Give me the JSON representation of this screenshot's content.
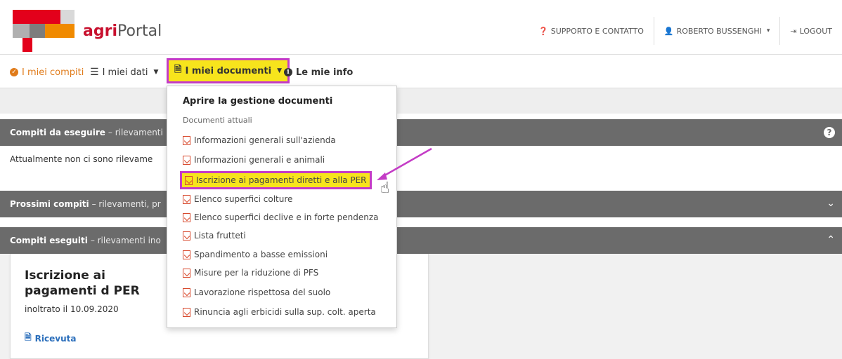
{
  "app": {
    "brand_prefix": "agri",
    "brand_suffix": "Portal"
  },
  "topbar": {
    "support": "SUPPORTO E CONTATTO",
    "user": "ROBERTO BUSSENGHI",
    "logout": "LOGOUT"
  },
  "nav": {
    "tasks": "I miei compiti",
    "data": "I miei dati",
    "documents": "I miei documenti",
    "info": "Le mie info"
  },
  "panels": {
    "todo": {
      "bold": "Compiti da eseguire",
      "rest": "– rilevamenti",
      "body": "Attualmente non ci sono rilevame"
    },
    "next": {
      "bold": "Prossimi compiti",
      "rest": "– rilevamenti, pr"
    },
    "done": {
      "bold": "Compiti eseguiti",
      "rest": "– rilevamenti ino"
    }
  },
  "card": {
    "title": "Iscrizione ai pagamenti d PER",
    "date": "inoltrato il 10.09.2020",
    "receipt": "Ricevuta"
  },
  "dropdown": {
    "header": "Aprire la gestione documenti",
    "section": "Documenti attuali",
    "items": [
      "Informazioni generali sull'azienda",
      "Informazioni generali e animali",
      "Iscrizione ai pagamenti diretti e alla PER",
      "Elenco superfici colture",
      "Elenco superfici declive e in forte pendenza",
      "Lista frutteti",
      "Spandimento a basse emissioni",
      "Misure per la riduzione di PFS",
      "Lavorazione rispettosa del suolo",
      "Rinuncia agli erbicidi sulla sup. colt. aperta"
    ],
    "highlighted_index": 2
  },
  "colors": {
    "highlight": "#f7e41c",
    "highlight_border": "#c43cc6",
    "accent_orange": "#e07b1a",
    "brand_red": "#c8102e",
    "panel_gray": "#6b6b6b",
    "link_blue": "#2a6ebb"
  }
}
